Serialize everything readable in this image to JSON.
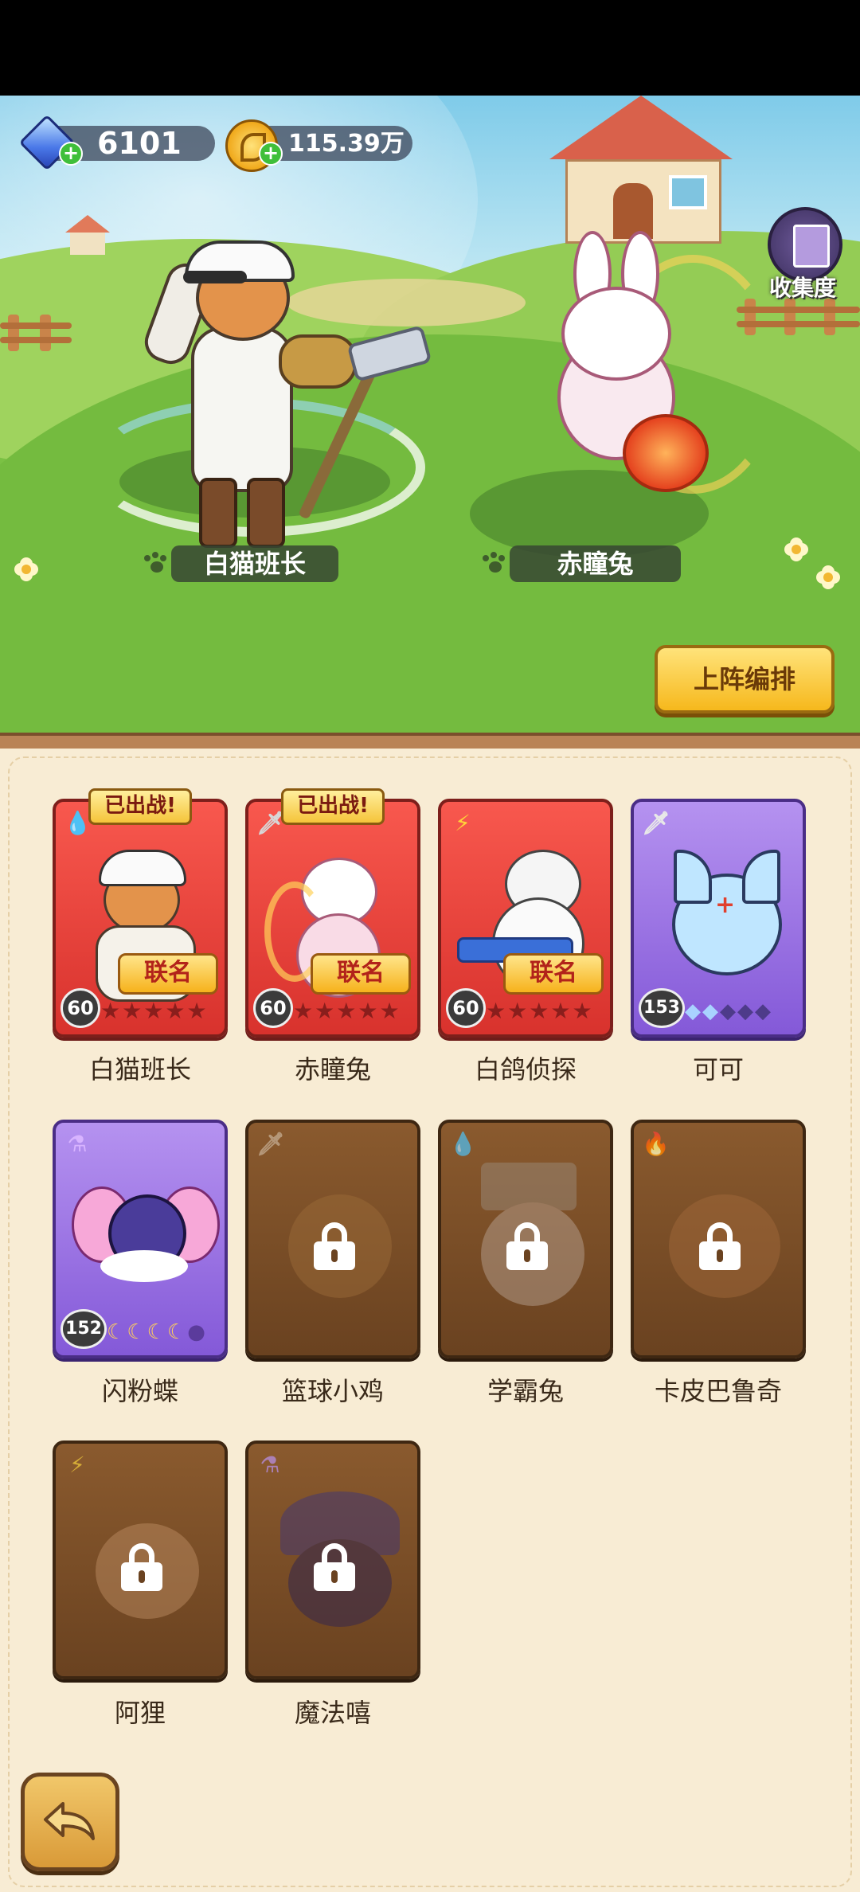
{
  "currencies": {
    "gems": "6101",
    "coins": "115.39万"
  },
  "collection_label": "收集度",
  "scene": {
    "hero_left_name": "白猫班长",
    "hero_right_name": "赤瞳兔"
  },
  "formation_button": "上阵编排",
  "deployed_label": "已出战!",
  "collab_label": "联名",
  "characters": [
    {
      "name": "白猫班长",
      "level": "60",
      "element": "water",
      "card": "red",
      "deployed": true,
      "collab": true,
      "locked": false
    },
    {
      "name": "赤瞳兔",
      "level": "60",
      "element": "sword",
      "card": "red",
      "deployed": true,
      "collab": true,
      "locked": false
    },
    {
      "name": "白鸽侦探",
      "level": "60",
      "element": "lightning",
      "card": "red",
      "deployed": false,
      "collab": true,
      "locked": false
    },
    {
      "name": "可可",
      "level": "153",
      "element": "sword",
      "card": "purple",
      "deployed": false,
      "collab": false,
      "locked": false,
      "stars_on": 2
    },
    {
      "name": "闪粉蝶",
      "level": "152",
      "element": "potion",
      "card": "purple",
      "deployed": false,
      "collab": false,
      "locked": false,
      "stars_on": 4
    },
    {
      "name": "篮球小鸡",
      "element": "sword",
      "locked": true
    },
    {
      "name": "学霸兔",
      "element": "water",
      "locked": true
    },
    {
      "name": "卡皮巴鲁奇",
      "element": "fire",
      "locked": true
    },
    {
      "name": "阿狸",
      "element": "lightning",
      "locked": true
    },
    {
      "name": "魔法嘻",
      "element": "potion",
      "locked": true
    }
  ],
  "colors": {
    "panel_bg": "#f8ecd4",
    "red_card": "#e6403a",
    "purple_card": "#9c72e2",
    "locked_card": "#7a4c26",
    "gold_button": "#f6b81c"
  }
}
